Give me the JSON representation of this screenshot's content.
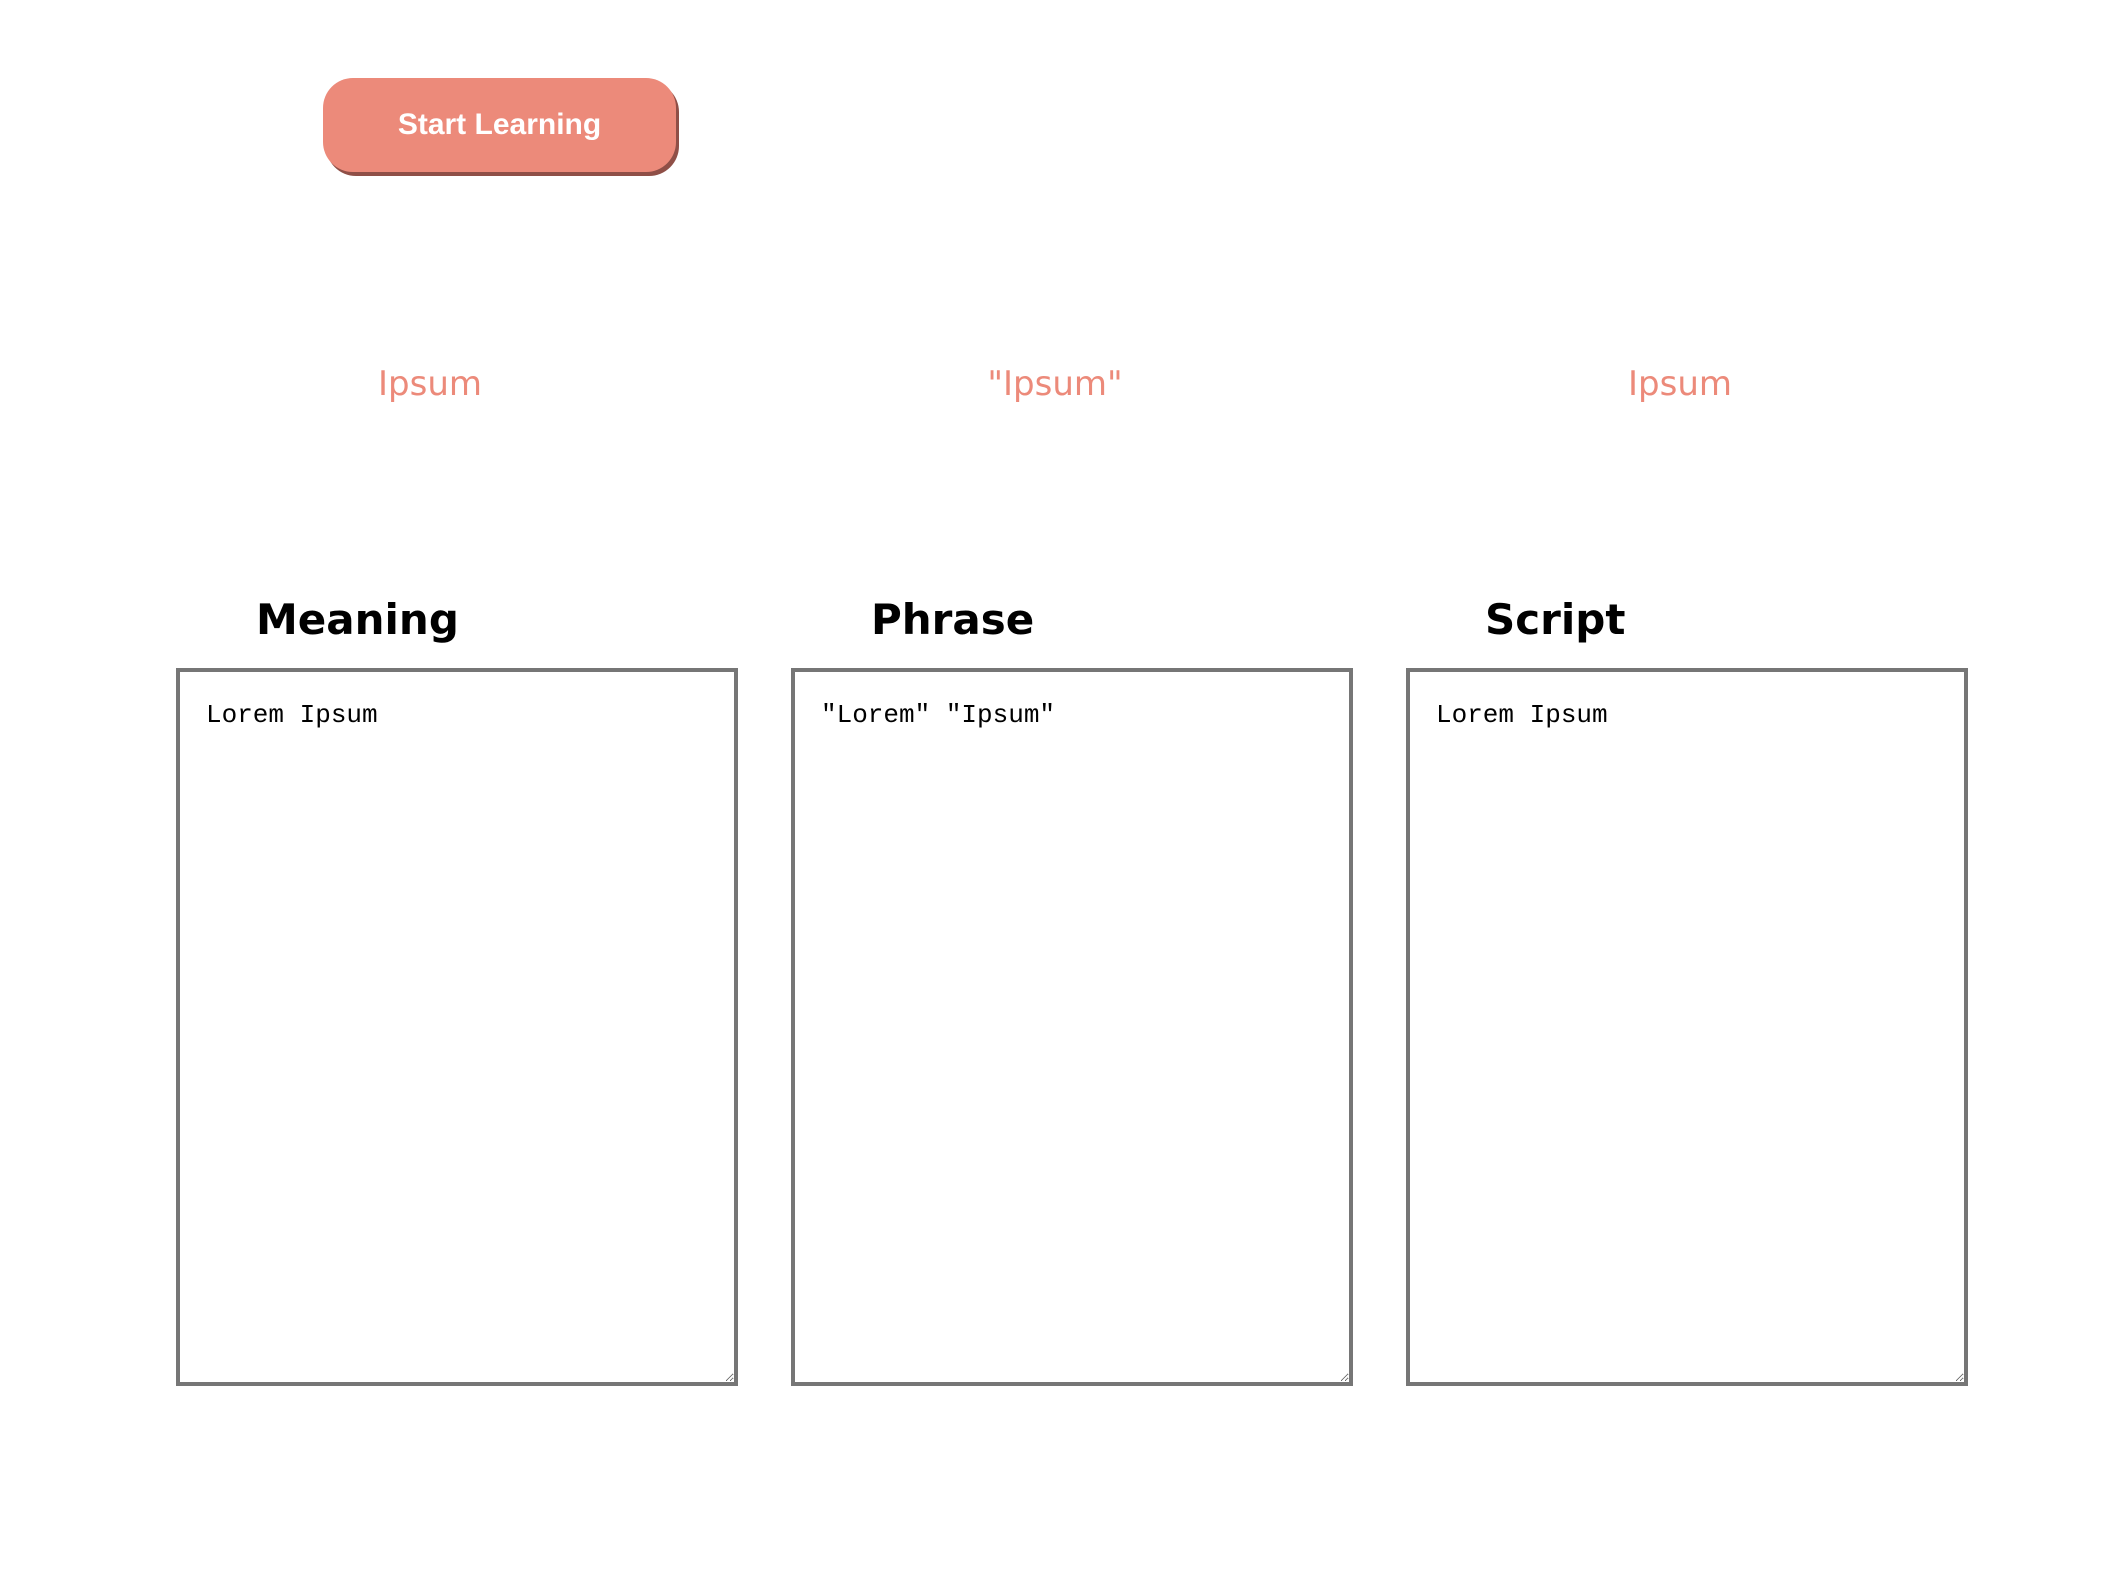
{
  "toolbar": {
    "start_label": "Start Learning"
  },
  "words": {
    "meaning": "Ipsum",
    "phrase": "\"Ipsum\"",
    "script": "Ipsum"
  },
  "columns": {
    "meaning": {
      "label": "Meaning",
      "value": "Lorem Ipsum"
    },
    "phrase": {
      "label": "Phrase",
      "value": "\"Lorem\" \"Ipsum\""
    },
    "script": {
      "label": "Script",
      "value": "Lorem Ipsum"
    }
  },
  "colors": {
    "accent": "#ec8a7a",
    "accent_shadow": "#8f4f47",
    "border": "#767676"
  }
}
